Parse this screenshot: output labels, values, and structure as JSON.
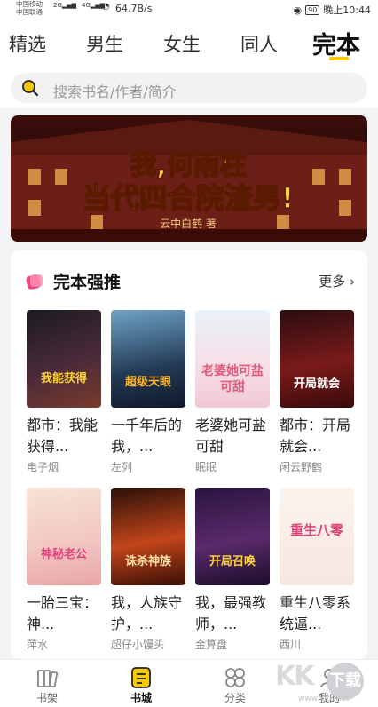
{
  "status_bar": {
    "carrier1": "中国移动",
    "carrier2": "中国联通",
    "signal1": "2G",
    "signal2": "4G",
    "net_speed": "64.7B/s",
    "battery": "90",
    "time": "晚上10:44"
  },
  "tabs": [
    "精选",
    "男生",
    "女生",
    "同人",
    "完本"
  ],
  "active_tab": "完本",
  "search": {
    "placeholder": "搜索书名/作者/简介"
  },
  "banner": {
    "headline1": "我,何雨柱",
    "headline2": "当代四合院渣男!",
    "author": "云中白鹤 著"
  },
  "section": {
    "title": "完本强推",
    "more": "更多"
  },
  "books": [
    {
      "title": "都市：我能获得...",
      "author": "电子烟",
      "cover_text": "我能获得"
    },
    {
      "title": "一千年后的我，...",
      "author": "左列",
      "cover_text": "超级天眼"
    },
    {
      "title": "老婆她可盐可甜",
      "author": "眠眠",
      "cover_text": "老婆她可盐可甜"
    },
    {
      "title": "都市：开局就会...",
      "author": "闲云野鹤",
      "cover_text": "开局就会"
    },
    {
      "title": "一胎三宝：神...",
      "author": "萍水",
      "cover_text": "神秘老公"
    },
    {
      "title": "我，人族守护，...",
      "author": "超仔小馒头",
      "cover_text": "诛杀神族"
    },
    {
      "title": "我，最强教师，...",
      "author": "金算盘",
      "cover_text": "开局召唤"
    },
    {
      "title": "重生八零系统逼...",
      "author": "西川",
      "cover_text": "重生八零"
    }
  ],
  "bottom_nav": [
    "书架",
    "书城",
    "分类",
    "我的"
  ],
  "active_nav": "书城",
  "watermark": {
    "brand": "KK",
    "badge": "下载",
    "url": "www.kkx.net"
  },
  "colors": {
    "accent": "#f7c900",
    "section_icon": "#f0457a"
  }
}
